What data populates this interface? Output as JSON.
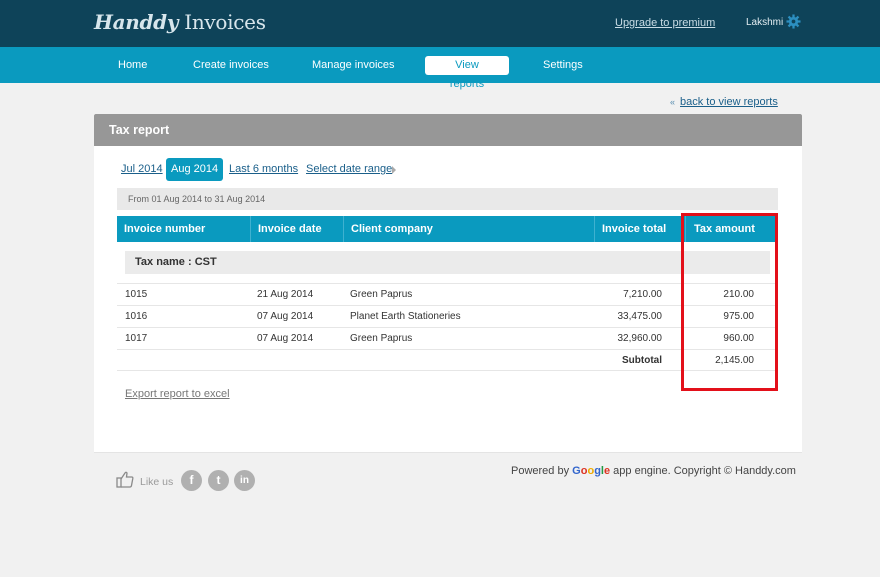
{
  "header": {
    "logo_script": "Handdy",
    "logo_rest": "Invoices",
    "upgrade_label": "Upgrade to premium",
    "user_name": "Lakshmi"
  },
  "nav": {
    "items": [
      "Home",
      "Create invoices",
      "Manage invoices",
      "View reports",
      "Settings"
    ],
    "active": "View reports"
  },
  "back_link": "back to view reports",
  "report": {
    "title": "Tax report",
    "periods": [
      "Jul 2014",
      "Aug 2014",
      "Last 6 months",
      "Select date range"
    ],
    "active_period": "Aug 2014",
    "date_range": "From 01 Aug 2014 to 31 Aug 2014",
    "columns": [
      "Invoice number",
      "Invoice date",
      "Client company",
      "Invoice total",
      "Tax amount"
    ],
    "tax_group": "Tax name : CST",
    "rows": [
      {
        "number": "1015",
        "date": "21 Aug 2014",
        "client": "Green Paprus",
        "total": "7,210.00",
        "tax": "210.00"
      },
      {
        "number": "1016",
        "date": "07 Aug 2014",
        "client": "Planet Earth Stationeries",
        "total": "33,475.00",
        "tax": "975.00"
      },
      {
        "number": "1017",
        "date": "07 Aug 2014",
        "client": "Green Paprus",
        "total": "32,960.00",
        "tax": "960.00"
      }
    ],
    "subtotal_label": "Subtotal",
    "subtotal_value": "2,145.00",
    "export_label": "Export report to excel"
  },
  "footer": {
    "like_label": "Like us",
    "social": [
      "f",
      "t",
      "in"
    ],
    "powered_prefix": "Powered by ",
    "google_word": "Google",
    "powered_suffix": " app engine. Copyright © Handdy.com"
  },
  "colors": {
    "topbar": "#0e4359",
    "navbar": "#0a9abf",
    "table_header": "#0a9abf",
    "highlight_box": "#e3101a"
  }
}
